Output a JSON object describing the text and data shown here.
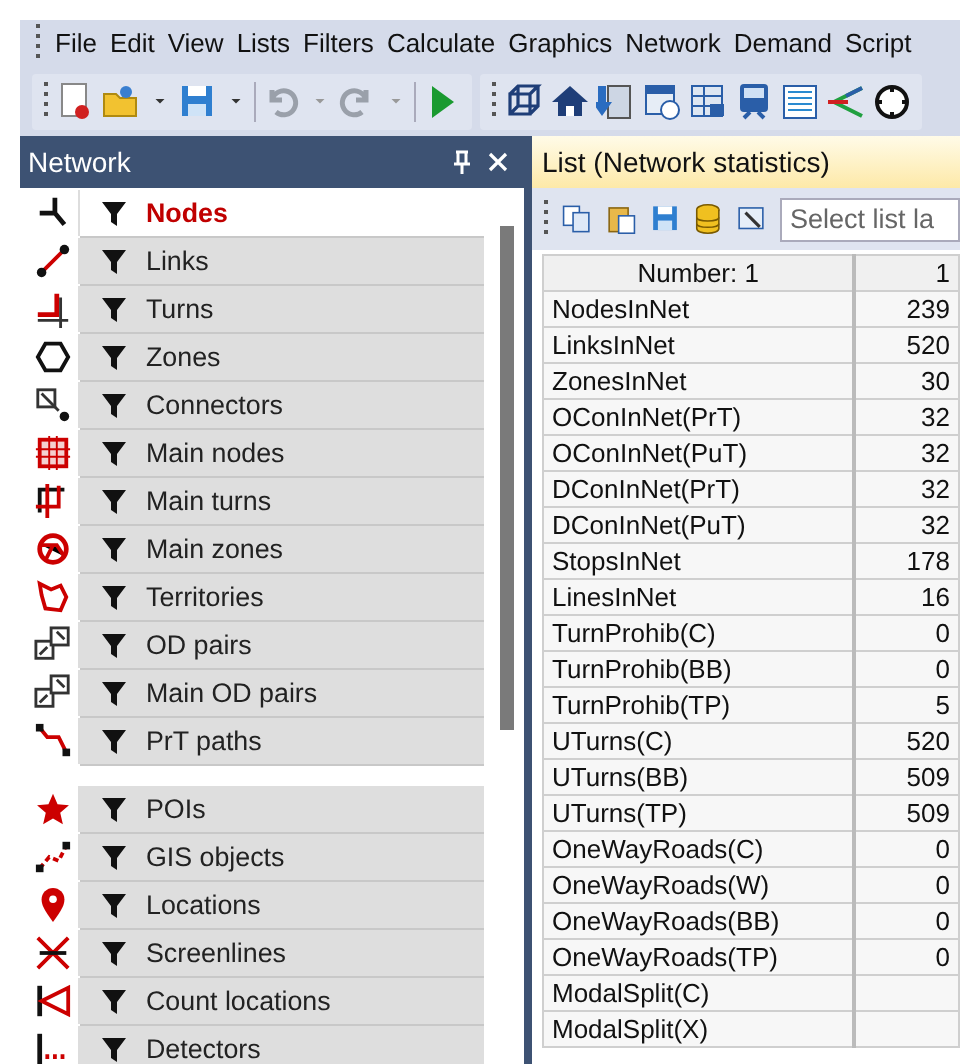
{
  "menu": [
    "File",
    "Edit",
    "View",
    "Lists",
    "Filters",
    "Calculate",
    "Graphics",
    "Network",
    "Demand",
    "Script"
  ],
  "network_panel": {
    "title": "Network",
    "items": [
      {
        "label": "Nodes",
        "selected": true
      },
      {
        "label": "Links",
        "selected": false
      },
      {
        "label": "Turns",
        "selected": false
      },
      {
        "label": "Zones",
        "selected": false
      },
      {
        "label": "Connectors",
        "selected": false
      },
      {
        "label": "Main nodes",
        "selected": false
      },
      {
        "label": "Main turns",
        "selected": false
      },
      {
        "label": "Main zones",
        "selected": false
      },
      {
        "label": "Territories",
        "selected": false
      },
      {
        "label": "OD pairs",
        "selected": false
      },
      {
        "label": "Main OD pairs",
        "selected": false
      },
      {
        "label": "PrT paths",
        "selected": false
      },
      {
        "kind": "gap"
      },
      {
        "label": "POIs",
        "selected": false
      },
      {
        "label": "GIS objects",
        "selected": false
      },
      {
        "label": "Locations",
        "selected": false
      },
      {
        "label": "Screenlines",
        "selected": false
      },
      {
        "label": "Count locations",
        "selected": false
      },
      {
        "label": "Detectors",
        "selected": false
      }
    ]
  },
  "list_panel": {
    "title": "List (Network statistics)",
    "search": {
      "placeholder": "Select list la"
    },
    "table": {
      "columns": [
        "Number: 1",
        "1"
      ],
      "rows": [
        {
          "name": "NodesInNet",
          "value": "239"
        },
        {
          "name": "LinksInNet",
          "value": "520"
        },
        {
          "name": "ZonesInNet",
          "value": "30"
        },
        {
          "name": "OConInNet(PrT)",
          "value": "32"
        },
        {
          "name": "OConInNet(PuT)",
          "value": "32"
        },
        {
          "name": "DConInNet(PrT)",
          "value": "32"
        },
        {
          "name": "DConInNet(PuT)",
          "value": "32"
        },
        {
          "name": "StopsInNet",
          "value": "178"
        },
        {
          "name": "LinesInNet",
          "value": "16"
        },
        {
          "name": "TurnProhib(C)",
          "value": "0"
        },
        {
          "name": "TurnProhib(BB)",
          "value": "0"
        },
        {
          "name": "TurnProhib(TP)",
          "value": "5"
        },
        {
          "name": "UTurns(C)",
          "value": "520"
        },
        {
          "name": "UTurns(BB)",
          "value": "509"
        },
        {
          "name": "UTurns(TP)",
          "value": "509"
        },
        {
          "name": "OneWayRoads(C)",
          "value": "0"
        },
        {
          "name": "OneWayRoads(W)",
          "value": "0"
        },
        {
          "name": "OneWayRoads(BB)",
          "value": "0"
        },
        {
          "name": "OneWayRoads(TP)",
          "value": "0"
        },
        {
          "name": "ModalSplit(C)"
        },
        {
          "name": "ModalSplit(X)"
        }
      ]
    }
  }
}
